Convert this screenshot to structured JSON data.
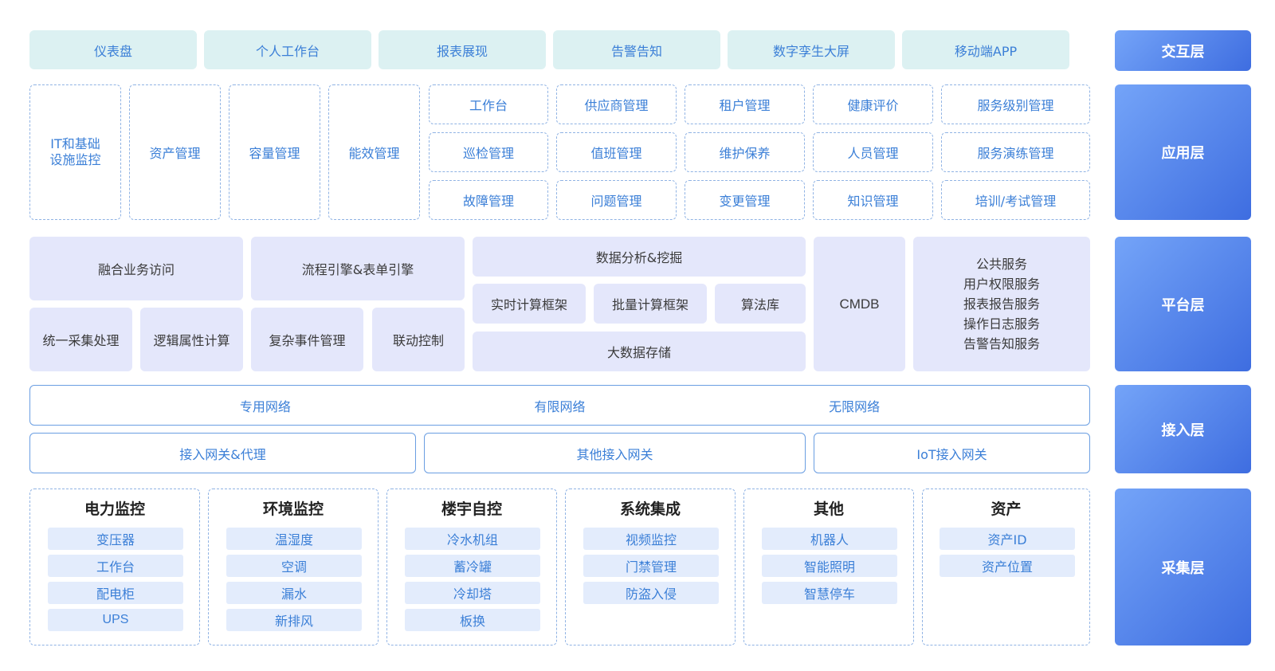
{
  "interaction": {
    "items": [
      "仪表盘",
      "个人工作台",
      "报表展现",
      "告警告知",
      "数字孪生大屏",
      "移动端APP"
    ]
  },
  "application": {
    "left": [
      "IT和基础\n设施监控",
      "资产管理",
      "容量管理",
      "能效管理"
    ],
    "grid": [
      [
        "工作台",
        "供应商管理",
        "租户管理",
        "健康评价",
        "服务级别管理"
      ],
      [
        "巡检管理",
        "值班管理",
        "维护保养",
        "人员管理",
        "服务演练管理"
      ],
      [
        "故障管理",
        "问题管理",
        "变更管理",
        "知识管理",
        "培训/考试管理"
      ]
    ]
  },
  "platform": {
    "fusion": "融合业务访问",
    "collect": "统一采集处理",
    "logic": "逻辑属性计算",
    "flow": "流程引擎&表单引擎",
    "event": "复杂事件管理",
    "linkage": "联动控制",
    "analysis": "数据分析&挖掘",
    "realtime": "实时计算框架",
    "batch": "批量计算框架",
    "algo": "算法库",
    "storage": "大数据存储",
    "cmdb": "CMDB",
    "public": [
      "公共服务",
      "用户权限服务",
      "报表报告服务",
      "操作日志服务",
      "告警告知服务"
    ]
  },
  "access": {
    "networks": [
      "专用网络",
      "有限网络",
      "无限网络"
    ],
    "gateways": [
      "接入网关&代理",
      "其他接入网关",
      "IoT接入网关"
    ]
  },
  "collection": {
    "columns": [
      {
        "title": "电力监控",
        "items": [
          "变压器",
          "工作台",
          "配电柜",
          "UPS"
        ]
      },
      {
        "title": "环境监控",
        "items": [
          "温湿度",
          "空调",
          "漏水",
          "新排风"
        ]
      },
      {
        "title": "楼宇自控",
        "items": [
          "冷水机组",
          "蓄冷罐",
          "冷却塔",
          "板换"
        ]
      },
      {
        "title": "系统集成",
        "items": [
          "视频监控",
          "门禁管理",
          "防盗入侵"
        ]
      },
      {
        "title": "其他",
        "items": [
          "机器人",
          "智能照明",
          "智慧停车"
        ]
      },
      {
        "title": "资产",
        "items": [
          "资产ID",
          "资产位置"
        ]
      }
    ]
  },
  "layers": [
    "交互层",
    "应用层",
    "平台层",
    "接入层",
    "采集层"
  ]
}
